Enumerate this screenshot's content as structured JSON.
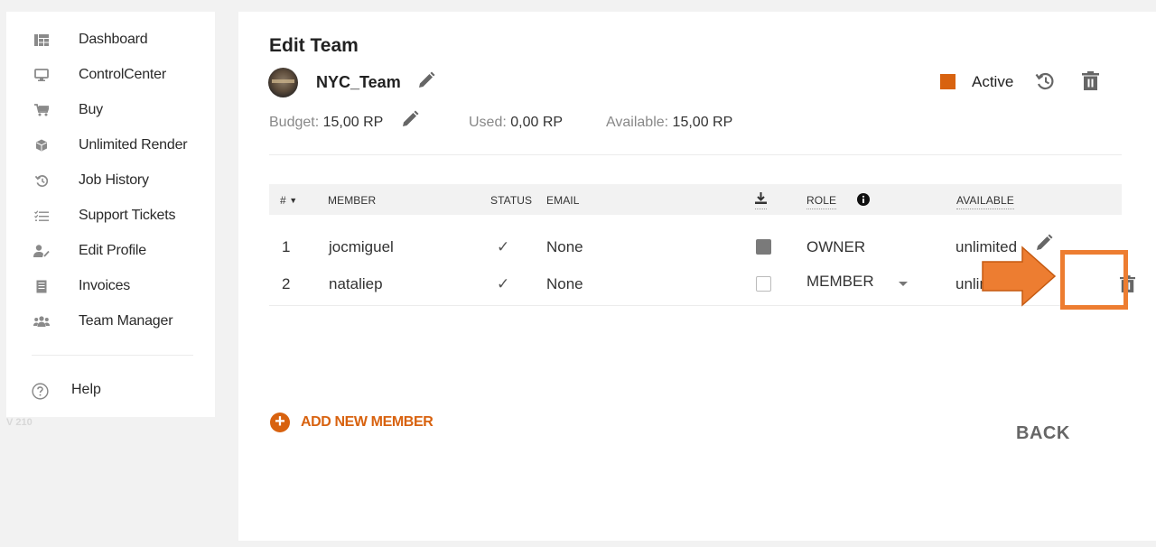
{
  "sidebar": {
    "items": [
      {
        "label": "Dashboard",
        "icon": "dashboard-icon"
      },
      {
        "label": "ControlCenter",
        "icon": "monitor-icon"
      },
      {
        "label": "Buy",
        "icon": "cart-icon"
      },
      {
        "label": "Unlimited Render",
        "icon": "cube-icon"
      },
      {
        "label": "Job History",
        "icon": "history-icon"
      },
      {
        "label": "Support Tickets",
        "icon": "checklist-icon"
      },
      {
        "label": "Edit Profile",
        "icon": "user-edit-icon"
      },
      {
        "label": "Invoices",
        "icon": "receipt-icon"
      },
      {
        "label": "Team Manager",
        "icon": "team-icon"
      }
    ],
    "help_label": "Help",
    "version": "V 210"
  },
  "page": {
    "title": "Edit Team",
    "team_name": "NYC_Team",
    "budget_label": "Budget:",
    "budget_value": "15,00 RP",
    "used_label": "Used:",
    "used_value": "0,00 RP",
    "available_label": "Available:",
    "available_value": "15,00 RP",
    "status_label": "Active",
    "status_color": "#d8620f"
  },
  "table": {
    "headers": {
      "index": "#",
      "member": "MEMBER",
      "status": "STATUS",
      "email": "EMAIL",
      "role": "ROLE",
      "available": "AVAILABLE"
    },
    "rows": [
      {
        "index": "1",
        "member": "jocmiguel",
        "status": "✓",
        "email": "None",
        "download": true,
        "role": "OWNER",
        "available": "unlimited"
      },
      {
        "index": "2",
        "member": "nataliep",
        "status": "✓",
        "email": "None",
        "download": false,
        "role": "MEMBER",
        "available": "unlimited"
      }
    ]
  },
  "actions": {
    "add_member": "ADD NEW MEMBER",
    "back": "BACK"
  },
  "annotation": {
    "highlight_color": "#ed7d31"
  }
}
